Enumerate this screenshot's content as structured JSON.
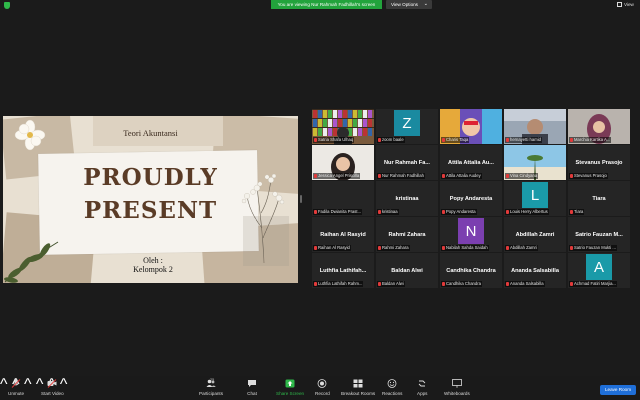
{
  "top": {
    "banner": "You are viewing Nur Rahmah Fadhillah's screen",
    "view_options": "View Options",
    "view": "View"
  },
  "slide": {
    "title": "Teori Akuntansi",
    "line1": "PROUDLY",
    "line2": "PRESENT",
    "oleh": "Oleh :",
    "group": "Kelompok 2"
  },
  "participants": [
    {
      "display": "",
      "caption": "Satria Shafa Ulhaq",
      "avatar": "",
      "video": "bookshelf",
      "active": true
    },
    {
      "display": "",
      "caption": "zoom baale",
      "avatar": "Z",
      "avatar_color": "#1a8aa0"
    },
    {
      "display": "",
      "caption": "Charis Taqa",
      "avatar": "",
      "video": "colorful"
    },
    {
      "display": "",
      "caption": "hernayetti hamid",
      "avatar": "",
      "video": "face-dark"
    },
    {
      "display": "",
      "caption": "Marchia Kartika A...",
      "avatar": "",
      "video": "hijab"
    },
    {
      "display": "",
      "caption": "Jessica Angel Priscilla",
      "avatar": "",
      "video": "face-light"
    },
    {
      "display": "Nur Rahmah Fa...",
      "caption": "Nur Rahmah Fadhillah",
      "avatar": ""
    },
    {
      "display": "Attila Attalia Au...",
      "caption": "Attila Attalia Audey",
      "avatar": ""
    },
    {
      "display": "",
      "caption": "Vina Cindyana",
      "avatar": "",
      "video": "sky"
    },
    {
      "display": "Stevanus Prasojo",
      "caption": "Stevanus Prasojo",
      "avatar": ""
    },
    {
      "display": "",
      "caption": "Fadila Dwianita Prast...",
      "avatar": "",
      "video": "none"
    },
    {
      "display": "kristinaa",
      "caption": "kristinaa",
      "avatar": ""
    },
    {
      "display": "Popy Andaresta",
      "caption": "Popy Andaresta",
      "avatar": ""
    },
    {
      "display": "",
      "caption": "Louis Herry Albertus",
      "avatar": "L",
      "avatar_color": "#1a9aa8"
    },
    {
      "display": "Tiara",
      "caption": "Tiara",
      "avatar": ""
    },
    {
      "display": "Raihan Al Rasyid",
      "caption": "Raihan Al Rasyid",
      "avatar": ""
    },
    {
      "display": "Rahmi Zahara",
      "caption": "Rahmi Zahara",
      "avatar": ""
    },
    {
      "display": "",
      "caption": "Nabilah Sahda Saidah",
      "avatar": "N",
      "avatar_color": "#7b3fb0"
    },
    {
      "display": "Abdillah Zamri",
      "caption": "Abdillah Zamri",
      "avatar": ""
    },
    {
      "display": "Satrio Fauzan M...",
      "caption": "Satrio Fauzan Mukti ...",
      "avatar": ""
    },
    {
      "display": "Luthfia Lathifah...",
      "caption": "Luthfia Lathifah Rahm...",
      "avatar": ""
    },
    {
      "display": "Baldan Alwi",
      "caption": "Baldan Alwi",
      "avatar": ""
    },
    {
      "display": "Candhika Chandra",
      "caption": "Candhika Chandra",
      "avatar": ""
    },
    {
      "display": "Ananda Salsabilla",
      "caption": "Ananda Salsabilla",
      "avatar": ""
    },
    {
      "display": "",
      "caption": "Achmad Fatiri Marjia...",
      "avatar": "A",
      "avatar_color": "#1a9aa8"
    }
  ],
  "toolbar": {
    "unmute": "Unmute",
    "start_video": "Start Video",
    "participants": "Participants",
    "participants_count": "25",
    "chat": "Chat",
    "share_screen": "Share Screen",
    "record": "Record",
    "breakout": "Breakout Rooms",
    "reactions": "Reactions",
    "apps": "Apps",
    "whiteboards": "Whiteboards",
    "leave": "Leave Room"
  },
  "colors": {
    "banner": "#22a33c",
    "leave": "#1f6fd9",
    "active_speaker": "#c8e51a",
    "slide_text": "#5a3b26",
    "share_screen_icon": "#2fb84a"
  }
}
